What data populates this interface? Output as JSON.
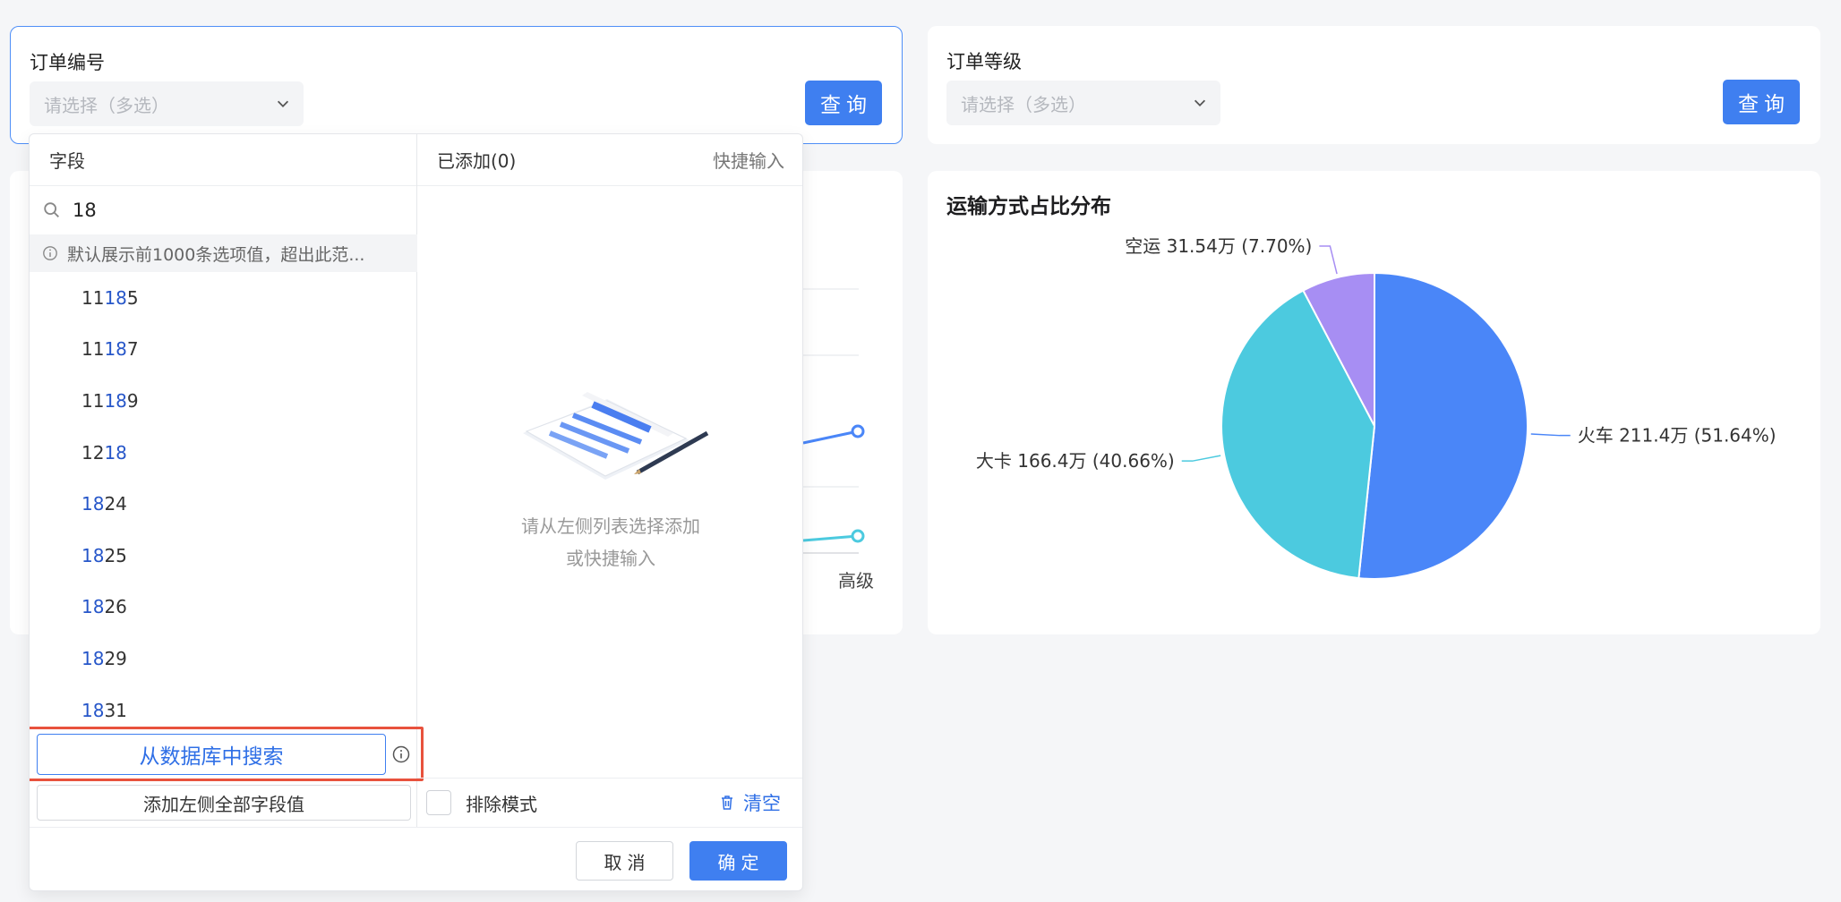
{
  "filters": [
    {
      "title": "订单编号",
      "placeholder": "请选择（多选）",
      "button": "查询"
    },
    {
      "title": "订单等级",
      "placeholder": "请选择（多选）",
      "button": "查询"
    }
  ],
  "left_chart": {
    "axis_label_visible": "高级"
  },
  "pie_chart": {
    "title": "运输方式占比分布"
  },
  "chart_data": {
    "type": "pie",
    "title": "运输方式占比分布",
    "categories": [
      "火车",
      "大卡",
      "空运"
    ],
    "values": [
      211.4,
      166.4,
      31.54
    ],
    "percent": [
      51.64,
      40.66,
      7.7
    ],
    "unit": "万",
    "labels": [
      "火车 211.4万 (51.64%)",
      "大卡 166.4万 (40.66%)",
      "空运 31.54万 (7.70%)"
    ],
    "colors": [
      "#4a86f8",
      "#4ccadf",
      "#a78ef3"
    ]
  },
  "panel": {
    "left_header": "字段",
    "right_header": "已添加(0)",
    "quick_input": "快捷输入",
    "search_value": "18",
    "tip": "默认展示前1000条选项值，超出此范...",
    "options": [
      {
        "pre": "11",
        "hl": "18",
        "post": "5",
        "full": "1185"
      },
      {
        "pre": "11",
        "hl": "18",
        "post": "7",
        "full": "1187"
      },
      {
        "pre": "11",
        "hl": "18",
        "post": "9",
        "full": "1189"
      },
      {
        "pre": "12",
        "hl": "18",
        "post": "",
        "full": "1218"
      },
      {
        "pre": "",
        "hl": "18",
        "post": "24",
        "full": "1824"
      },
      {
        "pre": "",
        "hl": "18",
        "post": "25",
        "full": "1825"
      },
      {
        "pre": "",
        "hl": "18",
        "post": "26",
        "full": "1826"
      },
      {
        "pre": "",
        "hl": "18",
        "post": "29",
        "full": "1829"
      },
      {
        "pre": "",
        "hl": "18",
        "post": "31",
        "full": "1831"
      }
    ],
    "db_search": "从数据库中搜索",
    "add_all": "添加左侧全部字段值",
    "empty_line1": "请从左侧列表选择添加",
    "empty_line2": "或快捷输入",
    "exclude_mode": "排除模式",
    "clear": "清空",
    "cancel": "取消",
    "ok": "确定"
  }
}
